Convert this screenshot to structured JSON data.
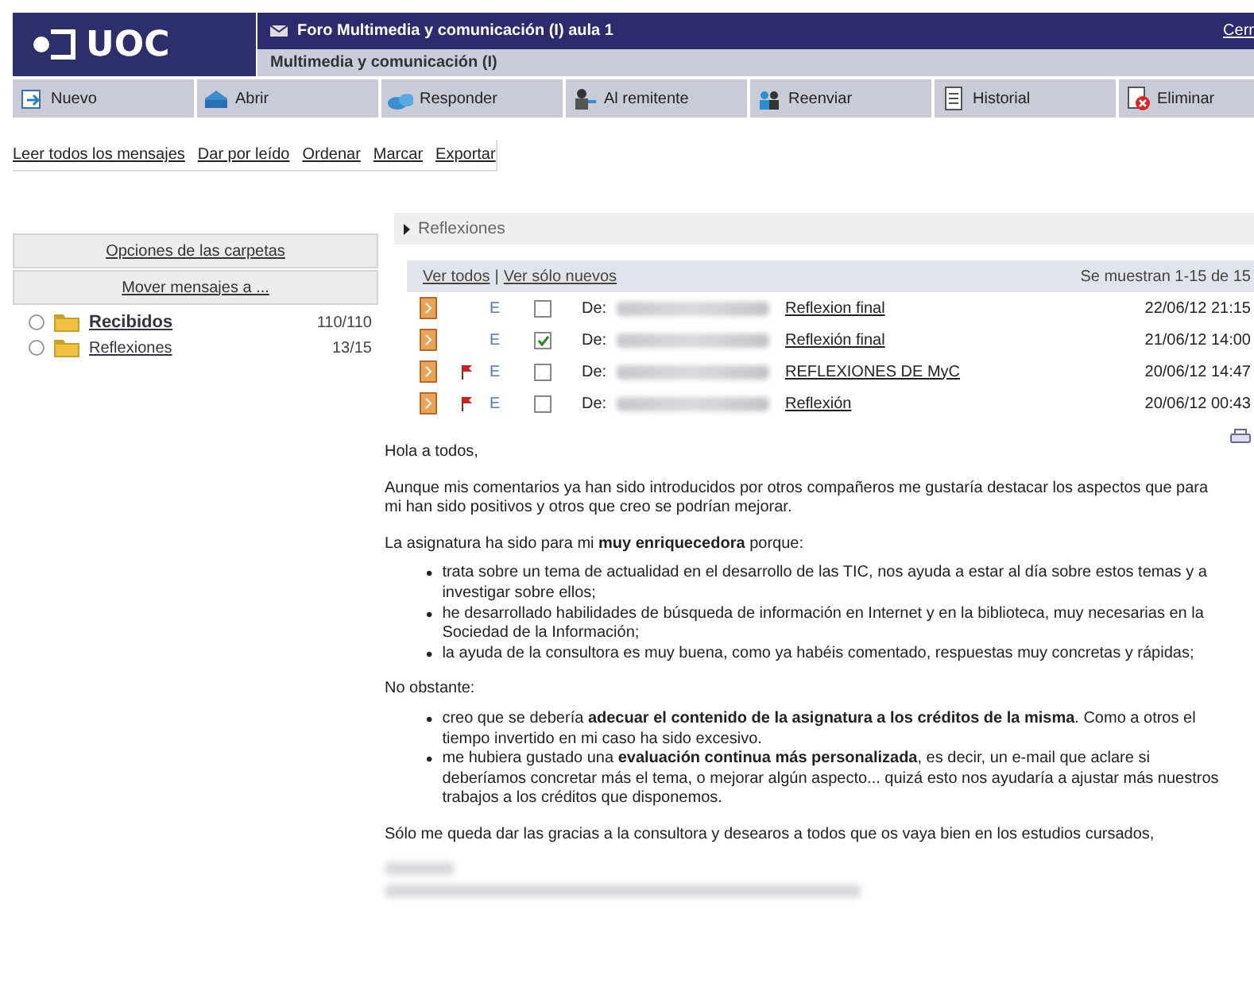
{
  "header": {
    "logo": "UOC",
    "title": "Foro Multimedia y comunicación (I) aula 1",
    "subtitle": "Multimedia y comunicación (I)",
    "close_link": "Cerr"
  },
  "toolbar": [
    {
      "label": "Nuevo"
    },
    {
      "label": "Abrir"
    },
    {
      "label": "Responder"
    },
    {
      "label": "Al remitente"
    },
    {
      "label": "Reenviar"
    },
    {
      "label": "Historial"
    },
    {
      "label": "Eliminar"
    }
  ],
  "actions": [
    "Leer todos los mensajes",
    "Dar por leído",
    "Ordenar",
    "Marcar",
    "Exportar"
  ],
  "folder_options": [
    "Opciones de las carpetas",
    "Mover mensajes a ..."
  ],
  "folders": [
    {
      "name": "Recibidos",
      "count": "110/110",
      "selected": false,
      "unread": true
    },
    {
      "name": "Reflexiones",
      "count": "13/15",
      "selected": false,
      "unread": false
    }
  ],
  "breadcrumb": "Reflexiones",
  "list": {
    "view_all": "Ver todos",
    "separator": "|",
    "view_new": "Ver sólo nuevos",
    "range": "Se muestran 1-15 de 15",
    "messages": [
      {
        "flagged": false,
        "status": "E",
        "checked": false,
        "from_label": "De:",
        "subject": "Reflexion final",
        "date": "22/06/12 21:15"
      },
      {
        "flagged": false,
        "status": "E",
        "checked": true,
        "from_label": "De:",
        "subject": "Reflexión final",
        "date": "21/06/12 14:00"
      },
      {
        "flagged": true,
        "status": "E",
        "checked": false,
        "from_label": "De:",
        "subject": "REFLEXIONES DE MyC",
        "date": "20/06/12 14:47"
      },
      {
        "flagged": true,
        "status": "E",
        "checked": false,
        "from_label": "De:",
        "subject": "Reflexión",
        "date": "20/06/12 00:43"
      }
    ]
  },
  "message": {
    "blocks": [
      {
        "kind": "paragraph",
        "text": "Hola a todos,"
      },
      {
        "kind": "paragraph",
        "text": "Aunque mis comentarios ya han sido introducidos por otros compañeros me gustaría destacar los aspectos que para mi han sido positivos y otros que creo se podrían mejorar."
      },
      {
        "kind": "paragraph",
        "text": "La asignatura ha sido para mi **muy enriquecedora** porque:"
      },
      {
        "kind": "list",
        "bullet": "•",
        "items": [
          "trata sobre un tema de actualidad en el desarrollo de las TIC, nos ayuda a estar al día sobre estos temas y a investigar sobre ellos;",
          "he desarrollado habilidades de búsqueda de información en Internet y en la biblioteca, muy necesarias en la Sociedad de la Información;",
          "la ayuda de la consultora es muy buena, como ya habéis comentado, respuestas muy concretas y rápidas;"
        ]
      },
      {
        "kind": "paragraph",
        "text": "No obstante:"
      },
      {
        "kind": "list",
        "bullet": "•",
        "items": [
          "creo que se debería **adecuar el contenido de la asignatura a los créditos de la misma**.  Como a otros el tiempo invertido en mi caso ha sido excesivo.",
          "me hubiera gustado una **evaluación continua más personalizada**, es decir, un e-mail que aclare si deberíamos concretar más el tema, o mejorar algún aspecto... quizá esto nos ayudaría a ajustar más nuestros trabajos a los créditos que disponemos."
        ]
      },
      {
        "kind": "paragraph",
        "text": "Sólo me queda dar las gracias a la consultora y desearos a todos que os vaya bien en los estudios cursados,"
      },
      {
        "kind": "signature"
      }
    ]
  }
}
